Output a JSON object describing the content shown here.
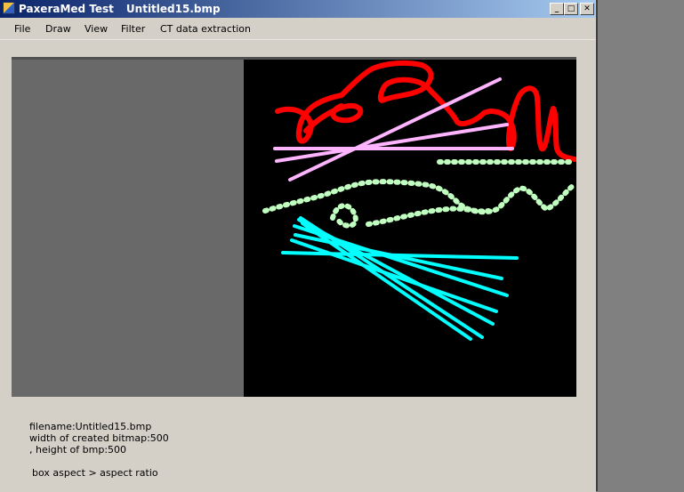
{
  "window": {
    "app_title": "PaxeraMed Test",
    "document_title": "Untitled15.bmp",
    "buttons": {
      "minimize": "_",
      "maximize": "□",
      "close": "✕"
    }
  },
  "menu": {
    "items": [
      "File",
      "Draw",
      "View",
      "Filter",
      "CT data extraction"
    ]
  },
  "info": {
    "filename_line": "filename:Untitled15.bmp",
    "width_line": "width of created bitmap:500",
    "height_line": ", height of bmp:500",
    "aspect_line": "box aspect > aspect ratio"
  },
  "colors": {
    "canvas_background": "#000000",
    "red_stroke": "#ff0000",
    "pink_stroke": "#ffb4ff",
    "lightgreen_stroke": "#c0ffc0",
    "cyan_stroke": "#00ffff"
  },
  "icons": {
    "app": "app-icon"
  }
}
